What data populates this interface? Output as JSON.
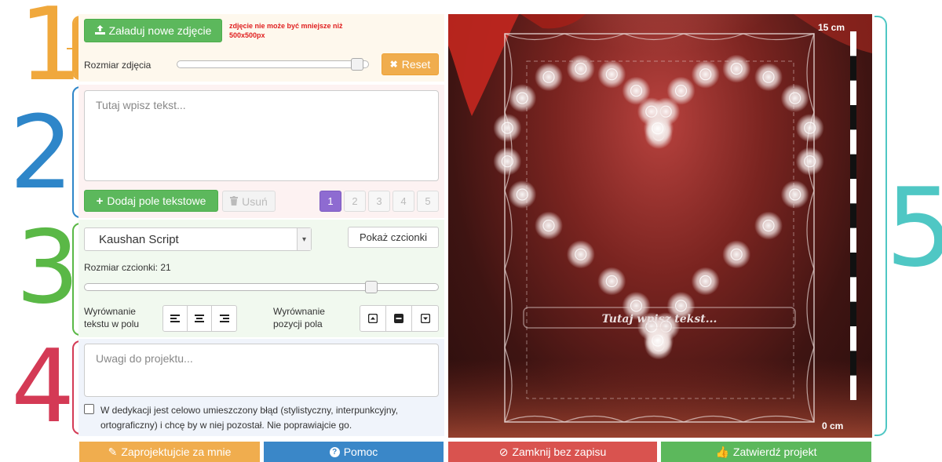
{
  "step_numbers": [
    "1",
    "2",
    "3",
    "4",
    "5"
  ],
  "photo": {
    "upload_label": "Załaduj nowe zdjęcie",
    "warning": "zdjęcie nie może być mniejsze niż 500x500px",
    "size_label": "Rozmiar zdjęcia",
    "size_level_fraction": 0.97,
    "reset_label": "Reset"
  },
  "text": {
    "placeholder": "Tutaj wpisz tekst...",
    "add_field_label": "Dodaj pole tekstowe",
    "remove_label": "Usuń",
    "pages": [
      "1",
      "2",
      "3",
      "4",
      "5"
    ],
    "active_page": "1"
  },
  "font": {
    "selected": "Kaushan Script",
    "show_fonts_label": "Pokaż czcionki",
    "size_label": "Rozmiar czcionki: 21",
    "size_level_fraction": 0.82,
    "text_align_label_1": "Wyrównanie",
    "text_align_label_2": "tekstu w polu",
    "pos_align_label_1": "Wyrównanie",
    "pos_align_label_2": "pozycji pola"
  },
  "notes": {
    "placeholder": "Uwagi do projektu...",
    "checkbox_label_1": "W dedykacji jest celowo umieszczony błąd (stylistyczny, interpunkcyjny,",
    "checkbox_label_2": "ortograficzny) i chcę by w niej pozostał. Nie poprawiajcie go.",
    "checked": false
  },
  "preview": {
    "overlay_text": "Tutaj wpisz tekst...",
    "ruler_top": "15 cm",
    "ruler_bottom": "0 cm"
  },
  "actions": {
    "design_for_me": "Zaprojektujcie za mnie",
    "help": "Pomoc",
    "close": "Zamknij bez zapisu",
    "approve": "Zatwierdź projekt"
  },
  "colors": {
    "step1": "#f0a83c",
    "step2": "#2e86c9",
    "step3": "#5ab846",
    "step4": "#d43a55",
    "step5": "#4fc7c4",
    "btn_orange": "#f0ad4e",
    "btn_blue": "#3a87c8",
    "btn_red": "#d9534f",
    "btn_green": "#5cb85c",
    "active_page": "#8e6bd1"
  }
}
